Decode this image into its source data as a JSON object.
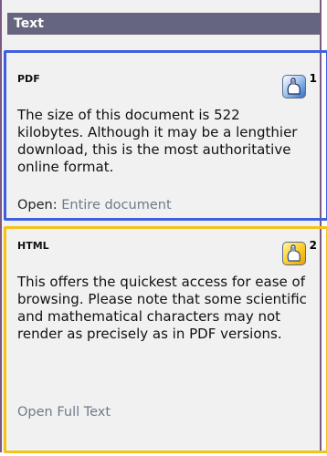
{
  "panel": {
    "heading": "Text"
  },
  "cards": [
    {
      "title": "PDF",
      "description": "The size of this document is 522 kilobytes. Although it may be a lengthier download, this is the most authoritative online format.",
      "open_label": "Open:",
      "open_link": "Entire document",
      "badge_number": "1",
      "badge_icon": "mouse-click-icon",
      "border_color": "#3f5fe0"
    },
    {
      "title": "HTML",
      "description": "This offers the quickest access for ease of browsing. Please note that some scientific and mathematical characters may not render as precisely as in PDF versions.",
      "open_link": "Open Full Text",
      "badge_number": "2",
      "badge_icon": "mouse-click-icon",
      "border_color": "#f2c31a"
    }
  ],
  "colors": {
    "header_bg": "#66657f",
    "panel_border": "#7a5a82",
    "panel_bg": "#f1f1f1"
  }
}
